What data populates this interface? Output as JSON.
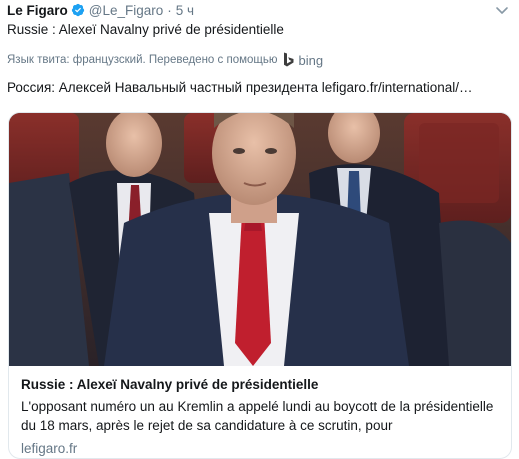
{
  "tweet": {
    "author_name": "Le Figaro",
    "handle": "@Le_Figaro",
    "separator": "·",
    "time": "5 ч",
    "text": "Russie : Alexeï Navalny privé de présidentielle"
  },
  "translation": {
    "notice": "Язык твита: французский. Переведено с помощью",
    "provider": "bing",
    "text": "Россия: Алексей Навальный частный президента lefigaro.fr/international/…"
  },
  "card": {
    "image_description": "photo of men in suits seated in a row of red chairs",
    "title": "Russie : Alexeï Navalny privé de présidentielle",
    "description": "L'opposant numéro un au Kremlin a appelé lundi au boycott de la présidentielle du 18 mars, après le rejet de sa candidature à ce scrutin, pour",
    "domain": "lefigaro.fr"
  },
  "colors": {
    "verified_blue": "#1da1f2",
    "muted_text": "#657786",
    "primary_text": "#14171a",
    "card_border": "#e1e8ed",
    "bing_teal": "#008373"
  },
  "icons": {
    "verified": "verified-badge-icon",
    "caret": "chevron-down-icon",
    "bing": "bing-logo-icon"
  }
}
